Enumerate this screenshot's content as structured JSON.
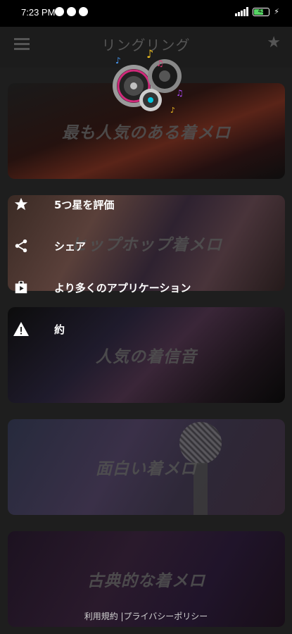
{
  "status_bar": {
    "time": "7:23 PM",
    "battery": "43",
    "battery_color": "#56d364"
  },
  "app_bar": {
    "title": "リングリング",
    "menu_icon": "hamburger-menu-icon",
    "star_icon": "star-icon"
  },
  "cards": [
    {
      "label": "最も人気のある着メロ"
    },
    {
      "label": "ヒップホップ着メロ"
    },
    {
      "label": "人気の着信音"
    },
    {
      "label": "面白い着メロ"
    },
    {
      "label": "古典的な着メロ"
    }
  ],
  "menu": {
    "items": [
      {
        "label": "5つ星を評価",
        "icon": "star-icon"
      },
      {
        "label": "シェア",
        "icon": "share-icon"
      },
      {
        "label": "より多くのアプリケーション",
        "icon": "play-store-bag-icon"
      },
      {
        "label": "約",
        "icon": "warning-icon"
      }
    ]
  },
  "footer": {
    "text": "利用規約 |プライバシーポリシー"
  }
}
